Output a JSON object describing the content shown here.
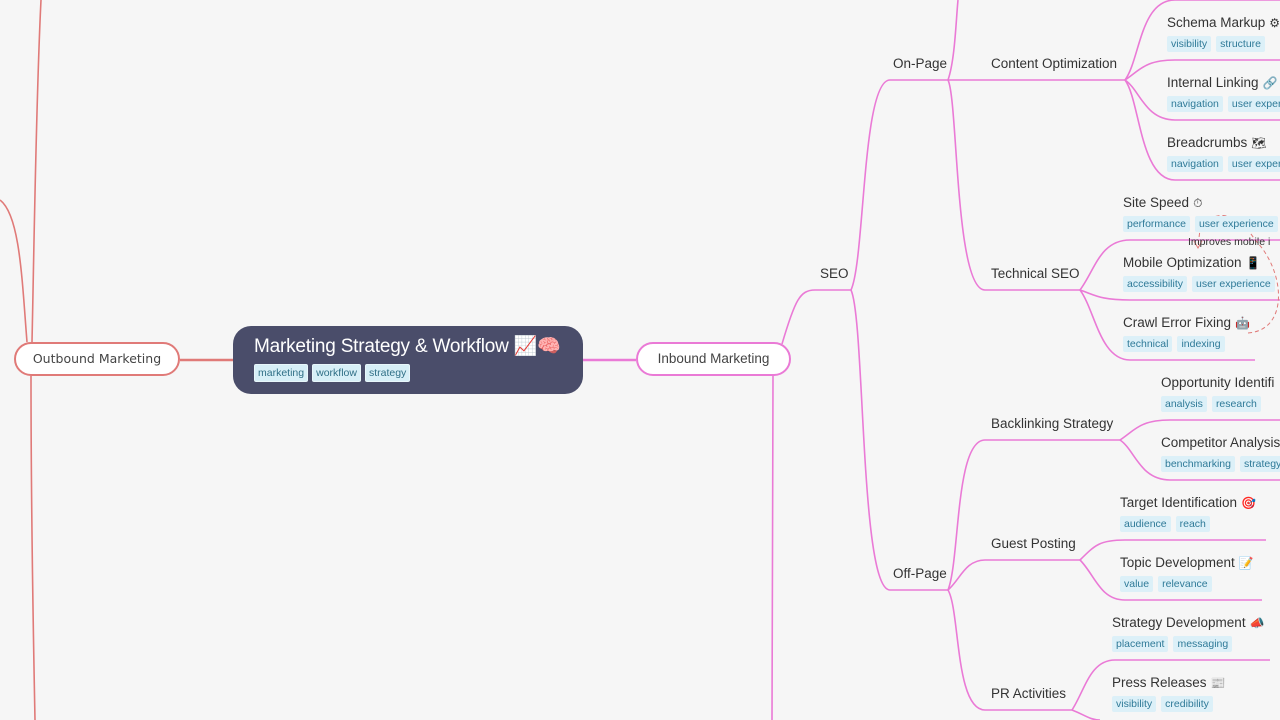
{
  "colors": {
    "background": "#f6f6f6",
    "root_fill": "#4a4d6a",
    "outbound_branch": "#e07a78",
    "inbound_branch": "#ea7ad6",
    "tag_fill": "#dcf0f8",
    "tag_text": "#2f7a98",
    "relationship_line": "#e07a78"
  },
  "root": {
    "title": "Marketing Strategy & Workflow",
    "emoji": "📈🧠",
    "tags": [
      "marketing",
      "workflow",
      "strategy"
    ]
  },
  "branches": {
    "outbound": {
      "label": "Outbound Marketing"
    },
    "inbound": {
      "label": "Inbound Marketing"
    }
  },
  "topics": {
    "seo": "SEO",
    "on_page": "On-Page",
    "content_optimization": "Content Optimization",
    "technical_seo": "Technical SEO",
    "off_page": "Off-Page",
    "backlinking_strategy": "Backlinking Strategy",
    "guest_posting": "Guest Posting",
    "pr_activities": "PR Activities"
  },
  "leaves": {
    "schema_markup": {
      "title": "Schema Markup",
      "emoji": "⚙",
      "tags": [
        "visibility",
        "structure"
      ]
    },
    "internal_linking": {
      "title": "Internal Linking",
      "emoji": "🔗",
      "tags": [
        "navigation",
        "user experi"
      ]
    },
    "breadcrumbs": {
      "title": "Breadcrumbs",
      "emoji": "🗺",
      "tags": [
        "navigation",
        "user experi"
      ]
    },
    "site_speed": {
      "title": "Site Speed",
      "emoji": "⏱",
      "tags": [
        "performance",
        "user experience"
      ]
    },
    "mobile_optimization": {
      "title": "Mobile Optimization",
      "emoji": "📱",
      "tags": [
        "accessibility",
        "user experience"
      ]
    },
    "crawl_error_fixing": {
      "title": "Crawl Error Fixing",
      "emoji": "🤖",
      "tags": [
        "technical",
        "indexing"
      ]
    },
    "opportunity_identification": {
      "title": "Opportunity Identifi",
      "emoji": "",
      "tags": [
        "analysis",
        "research"
      ]
    },
    "competitor_analysis": {
      "title": "Competitor Analysis",
      "emoji": "",
      "tags": [
        "benchmarking",
        "strategy"
      ]
    },
    "target_identification": {
      "title": "Target Identification",
      "emoji": "🎯",
      "tags": [
        "audience",
        "reach"
      ]
    },
    "topic_development": {
      "title": "Topic Development",
      "emoji": "📝",
      "tags": [
        "value",
        "relevance"
      ]
    },
    "strategy_development": {
      "title": "Strategy Development",
      "emoji": "📣",
      "tags": [
        "placement",
        "messaging"
      ]
    },
    "press_releases": {
      "title": "Press Releases",
      "emoji": "📰",
      "tags": [
        "visibility",
        "credibility"
      ]
    }
  },
  "relationship": {
    "label": "Improves mobile i"
  }
}
